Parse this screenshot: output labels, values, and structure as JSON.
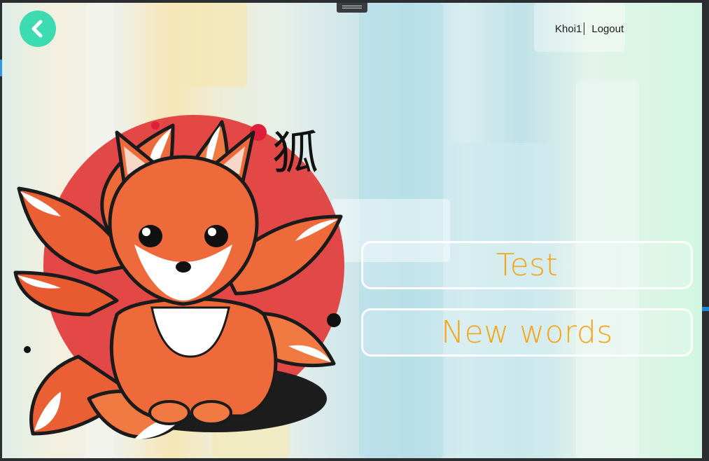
{
  "header": {
    "username": "Khoi1",
    "logout_label": "Logout"
  },
  "menu": {
    "test_label": "Test",
    "new_words_label": "New words"
  },
  "artwork": {
    "kanji": "狐"
  },
  "colors": {
    "accent_back": "#3ddbb0",
    "button_text": "#f5a516"
  },
  "icons": {
    "back": "chevron-left-icon"
  }
}
